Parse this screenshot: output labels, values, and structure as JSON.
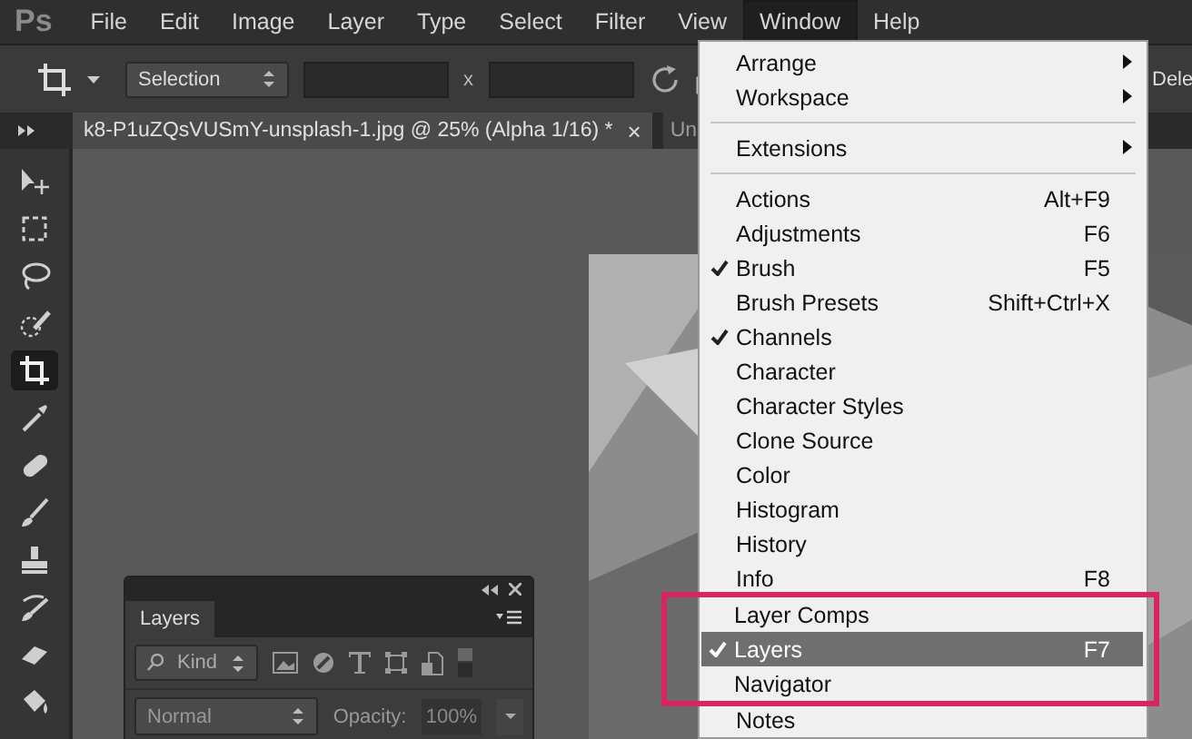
{
  "app": {
    "logo": "Ps"
  },
  "menu_bar": [
    {
      "label": "File",
      "selected": false
    },
    {
      "label": "Edit",
      "selected": false
    },
    {
      "label": "Image",
      "selected": false
    },
    {
      "label": "Layer",
      "selected": false
    },
    {
      "label": "Type",
      "selected": false
    },
    {
      "label": "Select",
      "selected": false
    },
    {
      "label": "Filter",
      "selected": false
    },
    {
      "label": "View",
      "selected": false
    },
    {
      "label": "Window",
      "selected": true
    },
    {
      "label": "Help",
      "selected": false
    }
  ],
  "options_bar": {
    "mode": "Selection",
    "times_label": "x",
    "trailing_label": "Dele"
  },
  "document_tabs": [
    {
      "label": "k8-P1uZQsVUSmY-unsplash-1.jpg @ 25% (Alpha 1/16) *",
      "close": "×",
      "selected": true
    },
    {
      "label": "Un",
      "selected": false
    }
  ],
  "tools": [
    {
      "kind": "move",
      "selected": false
    },
    {
      "kind": "marquee",
      "selected": false
    },
    {
      "kind": "lasso",
      "selected": false
    },
    {
      "kind": "quick-select",
      "selected": false
    },
    {
      "kind": "crop",
      "selected": true
    },
    {
      "kind": "eyedropper",
      "selected": false
    },
    {
      "kind": "healing",
      "selected": false
    },
    {
      "kind": "brush",
      "selected": false
    },
    {
      "kind": "stamp",
      "selected": false
    },
    {
      "kind": "history-brush",
      "selected": false
    },
    {
      "kind": "eraser",
      "selected": false
    },
    {
      "kind": "bucket",
      "selected": false
    }
  ],
  "layers_panel": {
    "title": "Layers",
    "filter": "Kind",
    "blend_mode": "Normal",
    "opacity_label": "Opacity:",
    "opacity": "100%"
  },
  "window_menu": {
    "items": [
      {
        "kind": "submenu",
        "label": "Arrange",
        "checked": false,
        "selected": false,
        "boxed": false
      },
      {
        "kind": "submenu",
        "label": "Workspace",
        "checked": false,
        "selected": false,
        "boxed": false
      },
      {
        "kind": "separator"
      },
      {
        "kind": "submenu",
        "label": "Extensions",
        "checked": false,
        "selected": false,
        "boxed": false
      },
      {
        "kind": "separator"
      },
      {
        "kind": "item",
        "label": "Actions",
        "shortcut": "Alt+F9",
        "checked": false,
        "selected": false,
        "boxed": false
      },
      {
        "kind": "item",
        "label": "Adjustments",
        "shortcut": "F6",
        "checked": false,
        "selected": false,
        "boxed": false
      },
      {
        "kind": "item",
        "label": "Brush",
        "shortcut": "F5",
        "checked": true,
        "selected": false,
        "boxed": false
      },
      {
        "kind": "item",
        "label": "Brush Presets",
        "shortcut": "Shift+Ctrl+X",
        "checked": false,
        "selected": false,
        "boxed": false
      },
      {
        "kind": "item",
        "label": "Channels",
        "checked": true,
        "selected": false,
        "boxed": false
      },
      {
        "kind": "item",
        "label": "Character",
        "checked": false,
        "selected": false,
        "boxed": false
      },
      {
        "kind": "item",
        "label": "Character Styles",
        "checked": false,
        "selected": false,
        "boxed": false
      },
      {
        "kind": "item",
        "label": "Clone Source",
        "checked": false,
        "selected": false,
        "boxed": false
      },
      {
        "kind": "item",
        "label": "Color",
        "checked": false,
        "selected": false,
        "boxed": false
      },
      {
        "kind": "item",
        "label": "Histogram",
        "checked": false,
        "selected": false,
        "boxed": false
      },
      {
        "kind": "item",
        "label": "History",
        "checked": false,
        "selected": false,
        "boxed": false
      },
      {
        "kind": "item",
        "label": "Info",
        "shortcut": "F8",
        "checked": false,
        "selected": false,
        "boxed": false
      },
      {
        "kind": "item",
        "label": "Layer Comps",
        "checked": false,
        "selected": false,
        "boxed": true
      },
      {
        "kind": "item",
        "label": "Layers",
        "shortcut": "F7",
        "checked": true,
        "selected": true,
        "boxed": true
      },
      {
        "kind": "item",
        "label": "Navigator",
        "checked": false,
        "selected": false,
        "boxed": true
      },
      {
        "kind": "item",
        "label": "Notes",
        "checked": false,
        "selected": false,
        "boxed": false
      }
    ]
  }
}
